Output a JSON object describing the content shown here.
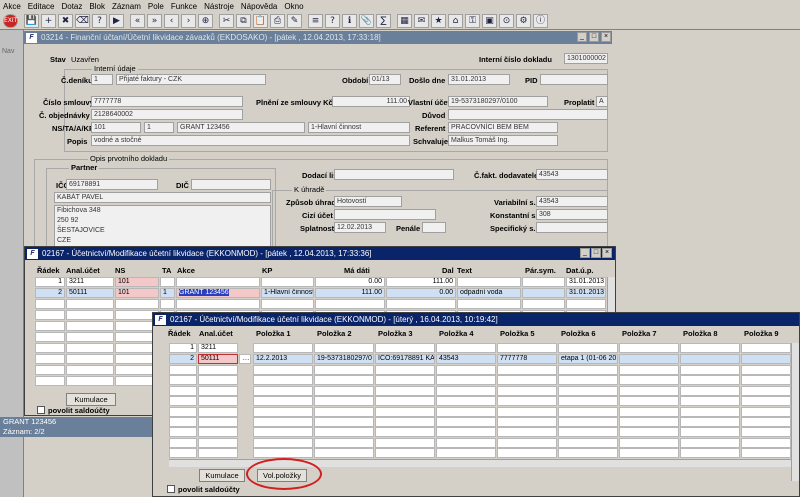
{
  "menu": [
    "Akce",
    "Editace",
    "Dotaz",
    "Blok",
    "Záznam",
    "Pole",
    "Funkce",
    "Nástroje",
    "Nápověda",
    "Okno"
  ],
  "toolbar_icons": [
    "exit-icon",
    "save-icon",
    "new-icon",
    "delete-icon",
    "clear-icon",
    "query-icon",
    "execute-query-icon",
    "prev-block-icon",
    "next-block-icon",
    "prev-record-icon",
    "next-record-icon",
    "insert-record-icon",
    "cut-icon",
    "copy-icon",
    "paste-icon",
    "print-icon",
    "edit-icon",
    "lov-icon",
    "help-icon",
    "info-icon",
    "attach-icon",
    "calc-icon",
    "calendar-icon",
    "mail-icon",
    "fav-icon",
    "tree-icon",
    "key-icon",
    "window-icon",
    "zoom-icon",
    "tools-icon",
    "about-icon"
  ],
  "nav_label": "Nav",
  "main_window": {
    "title": "03214 - Finanční účtaní/Účetní likvidace závazků (EKDOSAKO) - [pátek , 12.04.2013, 17:33:18]",
    "stav_label": "Stav",
    "stav_value": "Uzavřen",
    "interni_cislo_label": "Interní číslo dokladu",
    "interni_cislo_value": "1301000002",
    "interni_udaje_label": "Interní údaje",
    "c_deniku_label": "Č.deníku",
    "c_deniku_code": "1",
    "c_deniku_value": "Přijaté faktury - CZK",
    "obdobi_label": "Období",
    "obdobi_value": "01/13",
    "doslo_dne_label": "Došlo dne",
    "doslo_dne_value": "31.01.2013",
    "pid_label": "PID",
    "pid_value": "",
    "cislo_smlouvy_label": "Číslo smlouvy",
    "cislo_smlouvy_value": "7777778",
    "plneni_label": "Plnění ze smlouvy Kč",
    "plneni_value": "111.00",
    "vlastni_ucet_label": "Vlastní účet",
    "vlastni_ucet_value": "19-5373180297/0100",
    "proplatit_label": "Proplatit",
    "proplatit_value": "A",
    "c_objednavky_label": "Č. objednávky",
    "c_objednavky_value": "2128640002",
    "duvod_label": "Důvod",
    "duvod_value": "",
    "ns_label": "NS/TA/A/KP",
    "ns_value": "101",
    "ta_value": "1",
    "a_value": "GRANT 123456",
    "kp_value": "1-Hlavní činnost",
    "referent_label": "Referent",
    "referent_value": "PRACOVNÍCI BEM BEM",
    "popis_label": "Popis",
    "popis_value": "vodné a stočné",
    "schvaluje_label": "Schvaluje",
    "schvaluje_value": "Malkus Tomáš Ing.",
    "opis_label": "Opis prvotního dokladu",
    "partner_label": "Partner",
    "ico_label": "IČO",
    "ico_value": "69178891",
    "dic_label": "DIČ",
    "dic_value": "",
    "partner_name": "KABÁT PAVEL",
    "address_lines": [
      "Fibichova 348",
      "250 92",
      "ŠESTAJOVICE",
      "CZE"
    ],
    "dodaci_list_label": "Dodací list",
    "dodaci_list_value": "",
    "c_fakt_label": "Č.fakt. dodavatele",
    "c_fakt_value": "43543",
    "k_uhrade_label": "K úhradě",
    "zpusob_label": "Způsob úhrady",
    "zpusob_value": "Hotovostí",
    "variabilni_label": "Variabilní s.",
    "variabilni_value": "43543",
    "cizi_ucet_label": "Cizí účet",
    "cizi_ucet_value": "",
    "konstantni_label": "Konstantní s.",
    "konstantni_value": "308",
    "splatnost_label": "Splatnost",
    "splatnost_value": "12.02.2013",
    "penale_label": "Penále",
    "penale_value": "",
    "specificky_label": "Specifický s.",
    "specificky_value": ""
  },
  "status": {
    "line1": "GRANT 123456",
    "line2": "Záznam: 2/2"
  },
  "grid1": {
    "title": "02167 - Účetnictví/Modifikace účetní likvidace (EKKONMOD) - [pátek , 12.04.2013, 17:33:36]",
    "headers": [
      "Řádek",
      "Anal.účet",
      "NS",
      "TA",
      "Akce",
      "KP",
      "Má dáti",
      "Dal",
      "Text",
      "Pár.sym.",
      "Dat.ú.p."
    ],
    "rows": [
      {
        "radek": "1",
        "ucet": "3211",
        "ns": "101",
        "ta": "",
        "akce": "",
        "kp": "",
        "ma_dati": "0.00",
        "dal": "111.00",
        "text": "",
        "par": "",
        "dat": "31.01.2013"
      },
      {
        "radek": "2",
        "ucet": "50111",
        "ns": "101",
        "ta": "1",
        "akce": "GRANT 123456",
        "kp": "1-Hlavní činnost",
        "ma_dati": "111.00",
        "dal": "0.00",
        "text": "odpadní voda",
        "par": "",
        "dat": "31.01.2013"
      }
    ],
    "kumulace_label": "Kumulace",
    "povolit_label": "povolit saldoúčty"
  },
  "grid2": {
    "title": "02167 - Účetnictví/Modifikace účetní likvidace (EKKONMOD) - [úterý , 16.04.2013, 10:19:42]",
    "headers": [
      "Řádek",
      "Anal.účet",
      "Položka 1",
      "Položka 2",
      "Položka 3",
      "Položka 4",
      "Položka 5",
      "Položka 6",
      "Položka 7",
      "Položka 8",
      "Položka 9"
    ],
    "rows": [
      {
        "radek": "1",
        "ucet": "3211",
        "p1": "",
        "p2": "",
        "p3": "",
        "p4": "",
        "p5": "",
        "p6": ""
      },
      {
        "radek": "2",
        "ucet": "50111",
        "p1": "12.2.2013",
        "p2": "19-5373180297/0",
        "p3": "IČO:69178891 KA",
        "p4": "43543",
        "p5": "7777778",
        "p6": "etapa 1 (01-06 20"
      }
    ],
    "kumulace_label": "Kumulace",
    "vol_polozky_label": "Vol.položky",
    "povolit_label": "povolit saldoúčty"
  }
}
